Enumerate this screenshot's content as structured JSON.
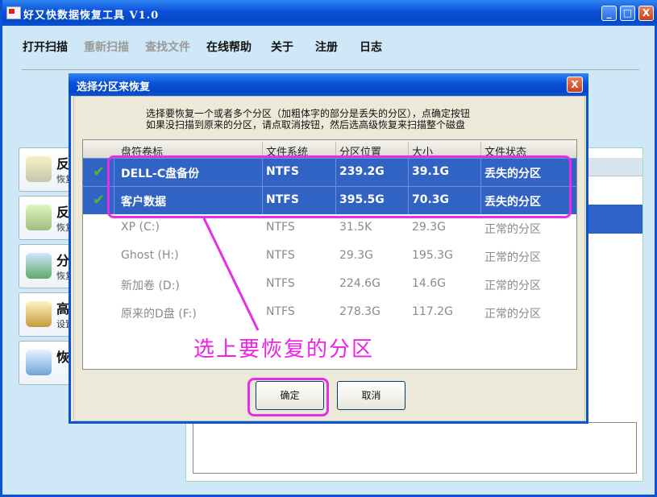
{
  "app": {
    "title": "好又快数据恢复工具 V1.0",
    "window_buttons": [
      "_",
      "□",
      "X"
    ]
  },
  "menu": [
    {
      "label": "打开扫描",
      "enabled": true
    },
    {
      "label": "重新扫描",
      "enabled": false
    },
    {
      "label": "查找文件",
      "enabled": false
    },
    {
      "label": "在线帮助",
      "enabled": true
    },
    {
      "label": "关于",
      "enabled": true
    },
    {
      "label": "注册",
      "enabled": true
    },
    {
      "label": "日志",
      "enabled": true
    }
  ],
  "sidebar": [
    {
      "label": "反",
      "sub": "恢复",
      "icon": "disk-undelete-icon"
    },
    {
      "label": "反",
      "sub": "恢复",
      "icon": "disk-format-icon"
    },
    {
      "label": "分",
      "sub": "恢复",
      "icon": "disk-partition-icon"
    },
    {
      "label": "高",
      "sub": "设置",
      "icon": "disk-search-icon"
    },
    {
      "label": "恢",
      "sub": "",
      "icon": "disk-recover-icon"
    }
  ],
  "dialog": {
    "title": "选择分区来恢复",
    "close": "X",
    "hint_line1": "选择要恢复一个或者多个分区（加粗体字的部分是丢失的分区），点确定按钮",
    "hint_line2": "如果没扫描到原来的分区，请点取消按钮，然后选高级恢复来扫描整个磁盘",
    "columns": [
      "盘符卷标",
      "文件系统",
      "分区位置",
      "大小",
      "文件状态"
    ],
    "rows": [
      {
        "checked": true,
        "selected": true,
        "name": "DELL-C盘备份",
        "fs": "NTFS",
        "pos": "239.2G",
        "size": "39.1G",
        "status": "丢失的分区"
      },
      {
        "checked": true,
        "selected": true,
        "name": "客户数据",
        "fs": "NTFS",
        "pos": "395.5G",
        "size": "70.3G",
        "status": "丢失的分区"
      },
      {
        "checked": false,
        "selected": false,
        "name": "XP  (C:)",
        "fs": "NTFS",
        "pos": "31.5K",
        "size": "29.3G",
        "status": "正常的分区"
      },
      {
        "checked": false,
        "selected": false,
        "name": "Ghost  (H:)",
        "fs": "NTFS",
        "pos": "29.3G",
        "size": "195.3G",
        "status": "正常的分区"
      },
      {
        "checked": false,
        "selected": false,
        "name": "新加卷  (D:)",
        "fs": "NTFS",
        "pos": "224.6G",
        "size": "14.6G",
        "status": "正常的分区"
      },
      {
        "checked": false,
        "selected": false,
        "name": "原来的D盘  (F:)",
        "fs": "NTFS",
        "pos": "278.3G",
        "size": "117.2G",
        "status": "正常的分区"
      }
    ],
    "ok_label": "确定",
    "cancel_label": "取消"
  },
  "annotation": {
    "text": "选上要恢复的分区",
    "color": "#e62ee6"
  },
  "colors": {
    "titlebar": "#0a53d4",
    "selection": "#3163c5",
    "check": "#5ab030"
  }
}
